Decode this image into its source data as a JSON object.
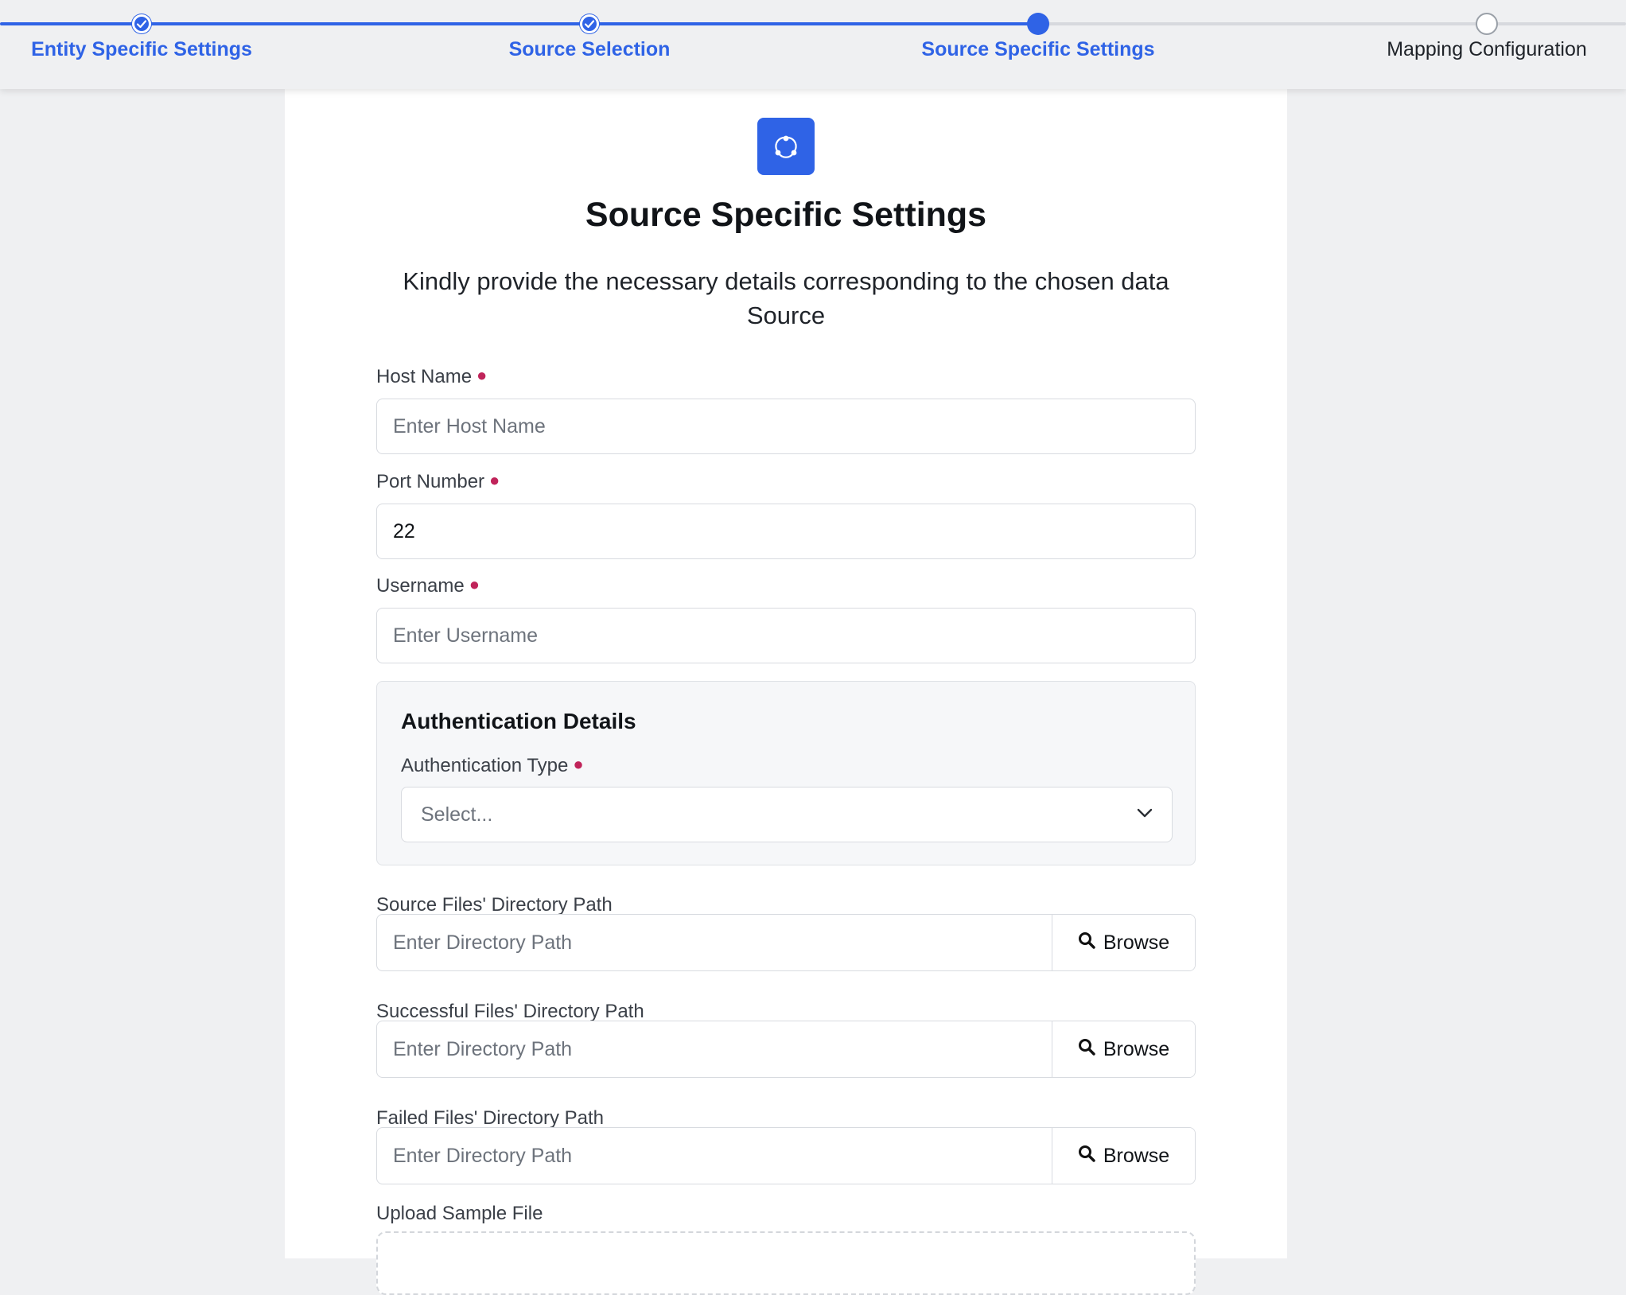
{
  "stepper": {
    "steps": [
      {
        "label": "Entity Specific Settings",
        "status": "completed"
      },
      {
        "label": "Source Selection",
        "status": "completed"
      },
      {
        "label": "Source Specific Settings",
        "status": "active"
      },
      {
        "label": "Mapping Configuration",
        "status": "pending"
      }
    ]
  },
  "header": {
    "icon": "share-nodes-icon",
    "title": "Source Specific Settings",
    "subtitle": "Kindly provide the necessary details corresponding to the chosen data Source"
  },
  "form": {
    "host_name": {
      "label": "Host Name",
      "placeholder": "Enter Host Name",
      "value": ""
    },
    "port_number": {
      "label": "Port Number",
      "value": "22"
    },
    "username": {
      "label": "Username",
      "placeholder": "Enter Username",
      "value": ""
    },
    "auth": {
      "title": "Authentication Details",
      "type_label": "Authentication Type",
      "type_value": "Select..."
    },
    "source_dir": {
      "label": "Source Files' Directory Path",
      "placeholder": "Enter Directory Path",
      "button": "Browse"
    },
    "success_dir": {
      "label": "Successful Files' Directory Path",
      "placeholder": "Enter Directory Path",
      "button": "Browse"
    },
    "failed_dir": {
      "label": "Failed Files' Directory Path",
      "placeholder": "Enter Directory Path",
      "button": "Browse"
    },
    "upload": {
      "label": "Upload Sample File"
    }
  },
  "colors": {
    "accent": "#2f63e6",
    "required": "#c0245a",
    "background": "#eff0f2"
  }
}
